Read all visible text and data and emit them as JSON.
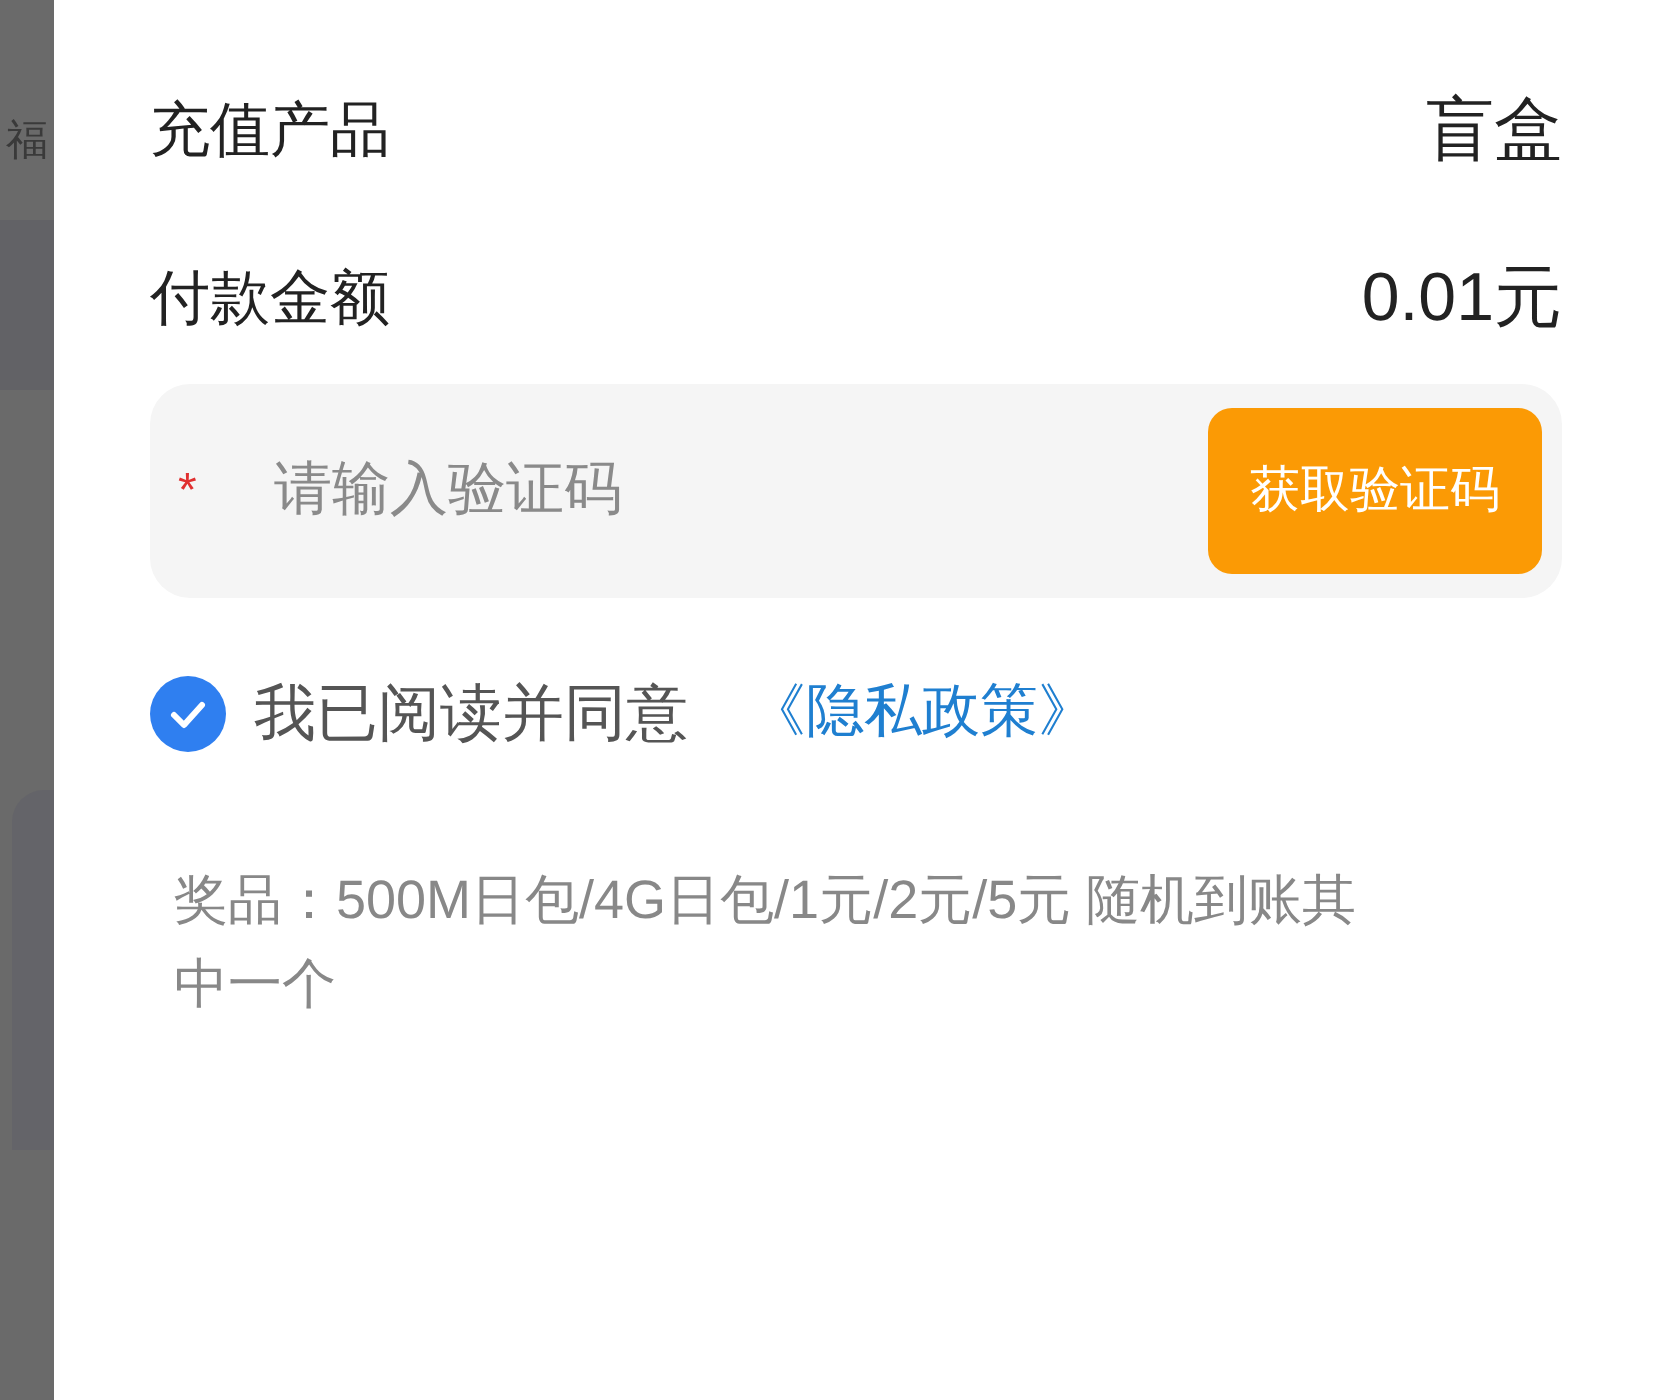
{
  "background": {
    "label": "福"
  },
  "rows": [
    {
      "label": "充值产品",
      "value": "盲盒"
    },
    {
      "label": "付款金额",
      "value": "0.01元"
    }
  ],
  "code_field": {
    "required_mark": "*",
    "placeholder": "请输入验证码",
    "button": "获取验证码"
  },
  "agreement": {
    "checked": true,
    "text": "我已阅读并同意",
    "link": "《隐私政策》"
  },
  "note": "奖品：500M日包/4G日包/1元/2元/5元 随机到账其中一个"
}
